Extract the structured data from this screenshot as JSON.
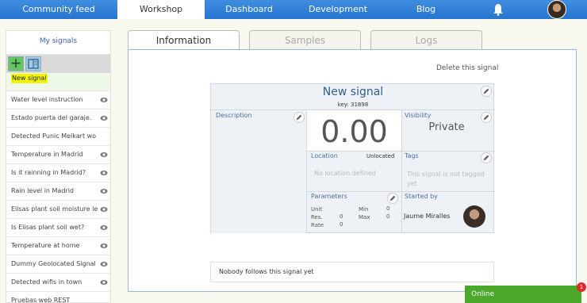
{
  "nav": {
    "tabs": [
      "Community feed",
      "Workshop",
      "Dashboard",
      "Development",
      "Blog"
    ],
    "active": "Workshop"
  },
  "sidebar": {
    "title": "My signals",
    "items": [
      {
        "label": "New signal",
        "eye": false
      },
      {
        "label": "Water level instruction",
        "eye": true
      },
      {
        "label": "Estado puerta del garaje.",
        "eye": true
      },
      {
        "label": "Detected Punic Melkart wo",
        "eye": false
      },
      {
        "label": "Temperature in Madrid",
        "eye": true
      },
      {
        "label": "Is it rainning in Madrid?",
        "eye": true
      },
      {
        "label": "Rain level in Madrid",
        "eye": true
      },
      {
        "label": "Elisas plant soil moisture le",
        "eye": true
      },
      {
        "label": "Is Elisas plant soil wet?",
        "eye": true
      },
      {
        "label": "Temperature at home",
        "eye": true
      },
      {
        "label": "Dummy Geolocated Signal",
        "eye": true
      },
      {
        "label": "Detected wifis in town",
        "eye": true
      },
      {
        "label": "Pruebas web REST",
        "eye": false
      }
    ]
  },
  "tabs": [
    "Information",
    "Samples",
    "Logs"
  ],
  "delete_label": "Delete this signal",
  "signal": {
    "name": "New signal",
    "key": "key: 31898",
    "description_label": "Description",
    "value": "0.00",
    "visibility_label": "Visibility",
    "visibility_value": "Private",
    "location_label": "Location",
    "location_status": "Unlocated",
    "location_hint": "No location defined",
    "tags_label": "Tags",
    "tags_hint": "This signal is not tagged yet",
    "parameters_label": "Parameters",
    "params": {
      "unit_label": "Unit",
      "res_label": "Res.",
      "res_value": "0",
      "rate_label": "Rate",
      "rate_value": "0",
      "min_label": "Min",
      "min_value": "0",
      "max_label": "Max",
      "max_value": "0"
    },
    "started_by_label": "Started by",
    "started_by_name": "Jaume Miralles"
  },
  "followers_text": "Nobody follows this signal yet",
  "chat": {
    "label": "Online",
    "badge": "1"
  },
  "colors": {
    "nav": "#2f80d8",
    "accent": "#4ba82b",
    "badge": "#e02a2a"
  }
}
